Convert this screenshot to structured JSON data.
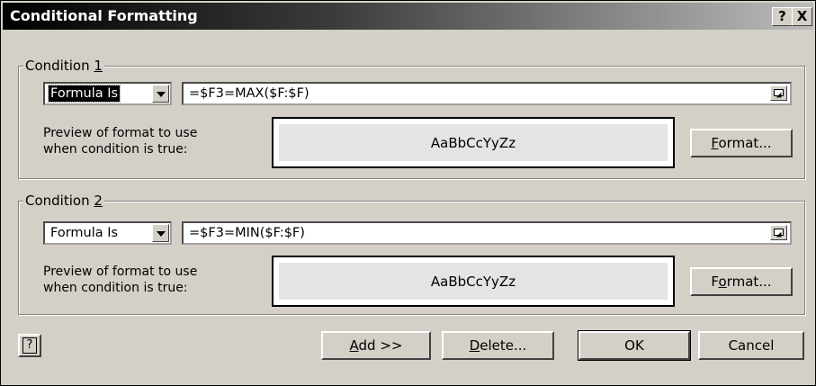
{
  "dialog": {
    "title": "Conditional Formatting",
    "help_glyph": "?",
    "close_glyph": "X"
  },
  "conditions": [
    {
      "label_prefix": "Condition ",
      "label_num": "1",
      "type": "Formula Is",
      "formula": "=$F3=MAX($F:$F)",
      "preview_label_line1": "Preview of format to use",
      "preview_label_line2": "when condition is true:",
      "preview_text": "AaBbCcYyZz",
      "format_pre": "",
      "format_hot": "F",
      "format_post": "ormat..."
    },
    {
      "label_prefix": "Condition ",
      "label_num": "2",
      "type": "Formula Is",
      "formula": "=$F3=MIN($F:$F)",
      "preview_label_line1": "Preview of format to use",
      "preview_label_line2": "when condition is true:",
      "preview_text": "AaBbCcYyZz",
      "format_pre": "F",
      "format_hot": "o",
      "format_post": "rmat..."
    }
  ],
  "buttons": {
    "add_hot": "A",
    "add_rest": "dd >>",
    "delete_hot": "D",
    "delete_rest": "elete...",
    "ok": "OK",
    "cancel": "Cancel",
    "help_glyph": "?"
  },
  "colors": {
    "dialog_bg": "#d4d0c8",
    "title_gradient_start": "#000000",
    "title_gradient_end": "#bcbcbc",
    "preview_fill": "#e4e4e4"
  },
  "icons": {
    "help": "question-mark-icon",
    "close": "close-icon",
    "dropdown": "chevron-down-icon",
    "collapse_dialog": "collapse-dialog-icon"
  }
}
